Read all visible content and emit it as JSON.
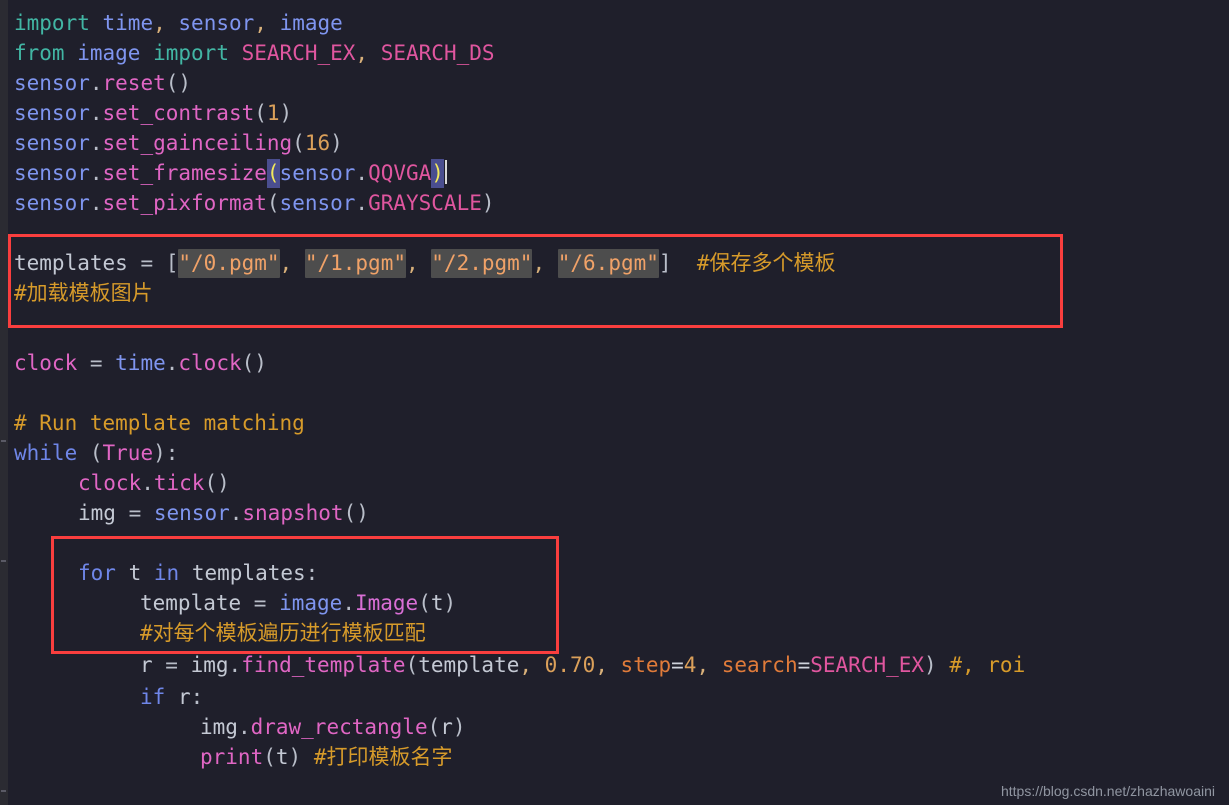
{
  "editor": {
    "background_color": "#1f1f2b",
    "gutter_color": "#2b2b32",
    "annotation_color": "#f93e3e",
    "match_highlight_color": "#4d4d4d",
    "bracket_highlight_color": "#4a4e8f"
  },
  "code": {
    "language": "python",
    "lines": [
      "import time, sensor, image",
      "from image import SEARCH_EX, SEARCH_DS",
      "sensor.reset()",
      "sensor.set_contrast(1)",
      "sensor.set_gainceiling(16)",
      "sensor.set_framesize(sensor.QQVGA)",
      "sensor.set_pixformat(sensor.GRAYSCALE)",
      "",
      "templates = [\"/0.pgm\", \"/1.pgm\", \"/2.pgm\", \"/6.pgm\"] #保存多个模板",
      "#加载模板图片",
      "",
      "clock = time.clock()",
      "",
      "# Run template matching",
      "while (True):",
      "    clock.tick()",
      "    img = sensor.snapshot()",
      "",
      "    for t in templates:",
      "        template = image.Image(t)",
      "        #对每个模板遍历进行模板匹配",
      "        r = img.find_template(template, 0.70, step=4, search=SEARCH_EX) #, roi",
      "        if r:",
      "            img.draw_rectangle(r)",
      "            print(t) #打印模板名字"
    ]
  },
  "tokens": {
    "l1": {
      "import": "import",
      "sp": " ",
      "time": "time",
      "c1": ",",
      "sensor": "sensor",
      "c2": ",",
      "image": "image"
    },
    "l2": {
      "from": "from",
      "image": "image",
      "import": "import",
      "search_ex": "SEARCH_EX",
      "comma": ",",
      "search_ds": "SEARCH_DS"
    },
    "l3": {
      "obj": "sensor",
      "dot": ".",
      "method": "reset",
      "parens": "()"
    },
    "l4": {
      "obj": "sensor",
      "dot": ".",
      "method": "set_contrast",
      "open": "(",
      "arg": "1",
      "close": ")"
    },
    "l5": {
      "obj": "sensor",
      "dot": ".",
      "method": "set_gainceiling",
      "open": "(",
      "arg": "16",
      "close": ")"
    },
    "l6": {
      "obj": "sensor",
      "dot": ".",
      "method": "set_framesize",
      "open": "(",
      "inner_obj": "sensor",
      "inner_dot": ".",
      "inner_const": "QQVGA",
      "close": ")"
    },
    "l7": {
      "obj": "sensor",
      "dot": ".",
      "method": "set_pixformat",
      "open": "(",
      "inner_obj": "sensor",
      "inner_dot": ".",
      "inner_const": "GRAYSCALE",
      "close": ")"
    },
    "l9": {
      "var": "templates",
      "eq": " = ",
      "lbracket": "[",
      "s0": "\"/0.pgm\"",
      "s1": "\"/1.pgm\"",
      "s2": "\"/2.pgm\"",
      "s6": "\"/6.pgm\"",
      "comma": ", ",
      "rbracket": "]",
      "comment": "#保存多个模板"
    },
    "l10": {
      "comment": "#加载模板图片"
    },
    "l12": {
      "var": "clock",
      "eq": " = ",
      "mod": "time",
      "dot": ".",
      "attr": "clock",
      "parens": "()"
    },
    "l14": {
      "comment": "# Run template matching"
    },
    "l15": {
      "kw": "while",
      "open": " (",
      "bool": "True",
      "close": "):"
    },
    "l16": {
      "obj": "clock",
      "dot": ".",
      "method": "tick",
      "parens": "()"
    },
    "l17": {
      "var": "img",
      "eq": " = ",
      "obj": "sensor",
      "dot": ".",
      "method": "snapshot",
      "parens": "()"
    },
    "l19": {
      "kw_for": "for",
      "v": "t",
      "kw_in": "in",
      "iter": "templates",
      "colon": ":"
    },
    "l20": {
      "var": "template",
      "eq": " = ",
      "mod": "image",
      "dot": ".",
      "cls": "Image",
      "open": "(",
      "arg": "t",
      "close": ")"
    },
    "l21": {
      "comment": "#对每个模板遍历进行模板匹配"
    },
    "l22": {
      "var": "r",
      "eq": " = ",
      "obj": "img",
      "dot": ".",
      "method": "find_template",
      "open": "(",
      "a1": "template",
      "comma1": ", ",
      "a2": "0.70",
      "comma2": ", ",
      "kw1": "step",
      "eq1": "=",
      "v1": "4",
      "comma3": ", ",
      "kw2": "search",
      "eq2": "=",
      "v2": "SEARCH_EX",
      "close": ")",
      "comment": "#, roi"
    },
    "l23": {
      "kw": "if",
      "v": "r",
      "colon": ":"
    },
    "l24": {
      "obj": "img",
      "dot": ".",
      "method": "draw_rectangle",
      "open": "(",
      "arg": "r",
      "close": ")"
    },
    "l25": {
      "builtin": "print",
      "open": "(",
      "arg": "t",
      "close": ")",
      "comment": "#打印模板名字"
    }
  },
  "annotations": [
    {
      "name": "templates-list-box",
      "label": "red rectangle around templates list and comment"
    },
    {
      "name": "for-loop-box",
      "label": "red rectangle around for loop body"
    }
  ],
  "watermark": {
    "text": "https://blog.csdn.net/zhazhawoaini"
  }
}
